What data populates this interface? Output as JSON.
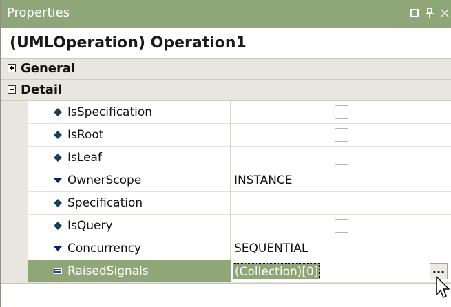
{
  "window": {
    "title": "Properties",
    "accent_color": "#8fa778"
  },
  "object": {
    "title": "(UMLOperation) Operation1"
  },
  "categories": [
    {
      "label": "General",
      "expanded": false
    },
    {
      "label": "Detail",
      "expanded": true
    }
  ],
  "properties": [
    {
      "name": "IsSpecification",
      "icon": "diamond-icon",
      "value": "",
      "type": "checkbox",
      "checked": false
    },
    {
      "name": "IsRoot",
      "icon": "diamond-icon",
      "value": "",
      "type": "checkbox",
      "checked": false
    },
    {
      "name": "IsLeaf",
      "icon": "diamond-icon",
      "value": "",
      "type": "checkbox",
      "checked": false
    },
    {
      "name": "OwnerScope",
      "icon": "dropdown-triangle-icon",
      "value": "INSTANCE",
      "type": "enum"
    },
    {
      "name": "Specification",
      "icon": "diamond-icon",
      "value": "",
      "type": "text"
    },
    {
      "name": "IsQuery",
      "icon": "diamond-icon",
      "value": "",
      "type": "checkbox",
      "checked": false
    },
    {
      "name": "Concurrency",
      "icon": "dropdown-triangle-icon",
      "value": "SEQUENTIAL",
      "type": "enum"
    },
    {
      "name": "RaisedSignals",
      "icon": "collection-icon",
      "value": "(Collection)[0]",
      "type": "collection",
      "selected": true,
      "button_label": "..."
    }
  ]
}
